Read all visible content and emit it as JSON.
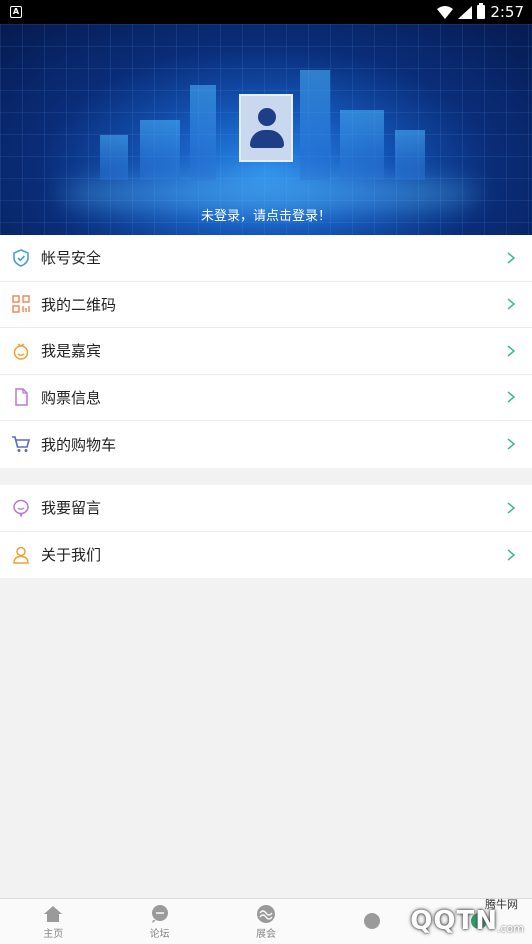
{
  "status_bar": {
    "time": "2:57",
    "sim_label": "A"
  },
  "header": {
    "login_prompt": "未登录，请点击登录！"
  },
  "menu_group_1": [
    {
      "label": "帐号安全",
      "icon": "shield-icon",
      "color": "#4a9fd8"
    },
    {
      "label": "我的二维码",
      "icon": "qrcode-icon",
      "color": "#f08a5d"
    },
    {
      "label": "我是嘉宾",
      "icon": "guest-icon",
      "color": "#f0a030"
    },
    {
      "label": "购票信息",
      "icon": "ticket-icon",
      "color": "#b57ad6"
    },
    {
      "label": "我的购物车",
      "icon": "cart-icon",
      "color": "#5c6bc0"
    }
  ],
  "menu_group_2": [
    {
      "label": "我要留言",
      "icon": "message-icon",
      "color": "#b57ad6"
    },
    {
      "label": "关于我们",
      "icon": "about-icon",
      "color": "#f0a030"
    }
  ],
  "bottom_nav": [
    {
      "label": "主页",
      "icon": "home-icon"
    },
    {
      "label": "论坛",
      "icon": "forum-icon"
    },
    {
      "label": "展会",
      "icon": "expo-icon"
    },
    {
      "label": "",
      "icon": "more-icon"
    },
    {
      "label": "",
      "icon": "me-icon"
    }
  ],
  "watermark": {
    "text": "QQTN",
    "small": "腾牛网",
    "domain": ".com"
  },
  "chevron_color": "#3dba8f"
}
